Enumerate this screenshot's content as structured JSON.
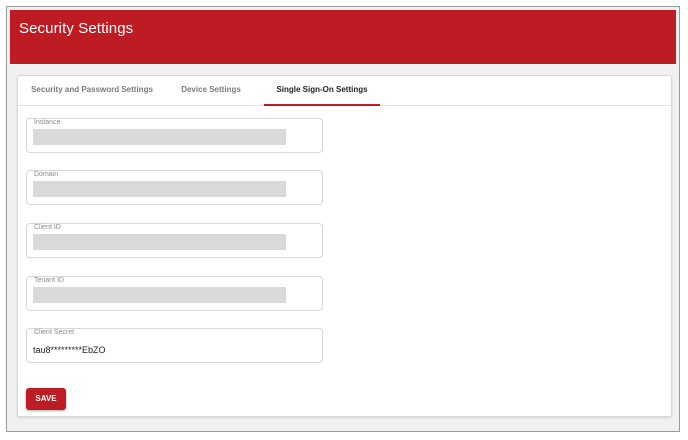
{
  "header": {
    "title": "Security Settings",
    "color": "#bc1c22"
  },
  "tabs": [
    {
      "label": "Security and Password Settings",
      "active": false
    },
    {
      "label": "Device Settings",
      "active": false
    },
    {
      "label": "Single Sign-On Settings",
      "active": true
    }
  ],
  "fields": {
    "instance": {
      "label": "Instance",
      "value_redacted": true
    },
    "domain": {
      "label": "Domain",
      "value_redacted": true
    },
    "client_id": {
      "label": "Client ID",
      "value_redacted": true
    },
    "tenant_id": {
      "label": "Tenant ID",
      "value_redacted": true
    },
    "client_secret": {
      "label": "Client Secret",
      "value": "tau8*********EbZO"
    }
  },
  "actions": {
    "save_label": "SAVE"
  }
}
